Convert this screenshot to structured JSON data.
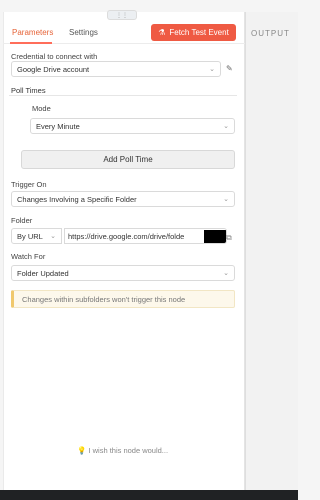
{
  "header": {
    "tabs": [
      {
        "label": "Parameters"
      },
      {
        "label": "Settings"
      }
    ],
    "fetch_button": "Fetch Test Event"
  },
  "output": {
    "label": "OUTPUT"
  },
  "credential": {
    "label": "Credential to connect with",
    "value": "Google Drive account"
  },
  "poll": {
    "section_label": "Poll Times",
    "mode_label": "Mode",
    "mode_value": "Every Minute",
    "add_button": "Add Poll Time"
  },
  "trigger": {
    "label": "Trigger On",
    "value": "Changes Involving a Specific Folder"
  },
  "folder": {
    "label": "Folder",
    "mode_value": "By URL",
    "url_value": "https://drive.google.com/drive/folde"
  },
  "watch": {
    "label": "Watch For",
    "value": "Folder Updated"
  },
  "notice": {
    "text": "Changes within subfolders won't trigger this node"
  },
  "footer": {
    "wish_text": "I wish this node would..."
  },
  "colors": {
    "accent": "#ef5a43",
    "tab_active": "#e66439"
  }
}
